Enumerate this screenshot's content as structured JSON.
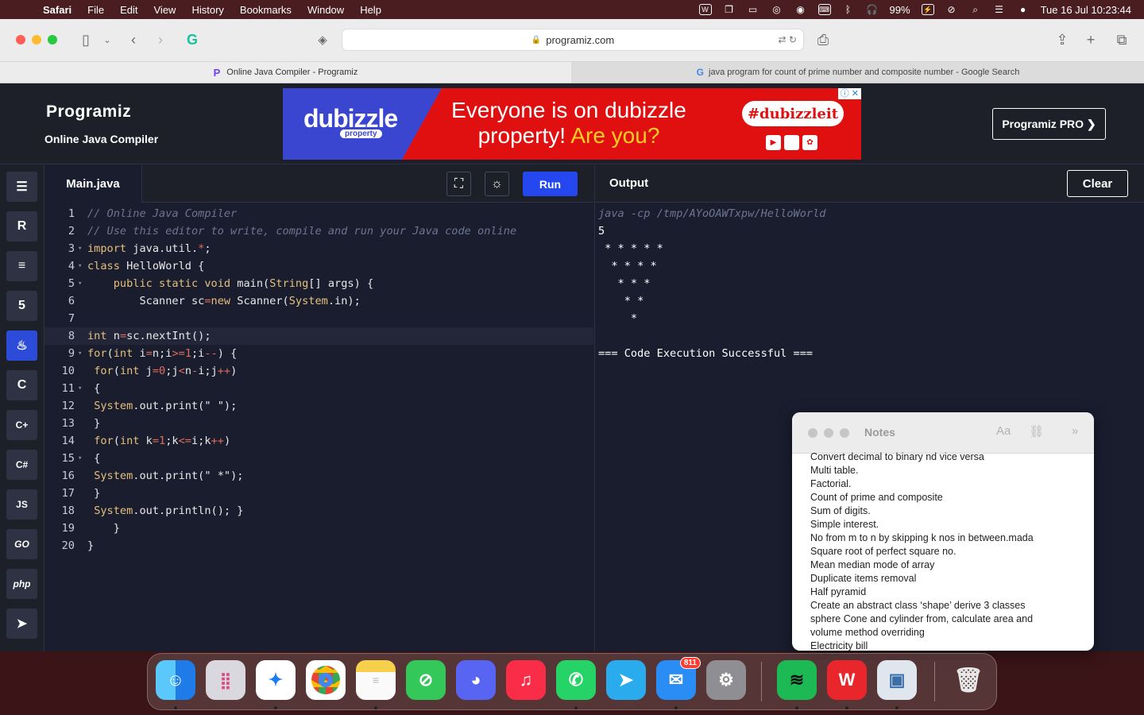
{
  "menubar": {
    "app": "Safari",
    "items": [
      "File",
      "Edit",
      "View",
      "History",
      "Bookmarks",
      "Window",
      "Help"
    ],
    "battery": "99%",
    "clock": "Tue 16 Jul  10:23:44"
  },
  "browser": {
    "url": "programiz.com",
    "tabs": [
      {
        "title": "Online Java Compiler - Programiz"
      },
      {
        "title": "java program for count of prime number and composite number - Google Search"
      }
    ]
  },
  "site": {
    "logo": "Programiz",
    "subtitle": "Online Java Compiler",
    "pro_button": "Programiz PRO ❯",
    "ad": {
      "brand": "dubizzle",
      "brand_sub": "property",
      "line1": "Everyone is on dubizzle",
      "line2a": "property!",
      "line2b": "Are you?",
      "hashtag": "#dubizzleit"
    }
  },
  "sidebar_langs": [
    {
      "name": "python",
      "glyph": "☰"
    },
    {
      "name": "r",
      "glyph": "R"
    },
    {
      "name": "sql",
      "glyph": "≡"
    },
    {
      "name": "html",
      "glyph": "5"
    },
    {
      "name": "java",
      "glyph": "♨"
    },
    {
      "name": "c",
      "glyph": "C"
    },
    {
      "name": "cpp",
      "glyph": "C+"
    },
    {
      "name": "csharp",
      "glyph": "C#"
    },
    {
      "name": "js",
      "glyph": "JS"
    },
    {
      "name": "go",
      "glyph": "GO"
    },
    {
      "name": "php",
      "glyph": "php"
    },
    {
      "name": "swift",
      "glyph": "➤"
    }
  ],
  "editor": {
    "filename": "Main.java",
    "run_label": "Run"
  },
  "output": {
    "title": "Output",
    "clear_label": "Clear",
    "lines": [
      "java -cp /tmp/AYoOAWTxpw/HelloWorld",
      "5",
      " * * * * *",
      "  * * * *",
      "   * * *",
      "    * *",
      "     *",
      "",
      "=== Code Execution Successful ==="
    ]
  },
  "notes": {
    "title": "Notes",
    "lines": [
      "Convert decimal to binary nd vice versa",
      "Multi table.",
      "Factorial.",
      "Count of prime and composite",
      "Sum of digits.",
      "Simple interest.",
      "No from m to n by skipping k nos in between.mada",
      "Square root of perfect square no.",
      "Mean median mode of array",
      "Duplicate items removal",
      "Half pyramid",
      "Create an abstract class ‘shape’ derive 3 classes",
      "sphere Cone and cylinder from, calculate area and",
      "volume method overriding",
      "Electricity bill"
    ]
  },
  "dock": {
    "apps": [
      "Finder",
      "Launchpad",
      "Safari",
      "Chrome",
      "Notes",
      "Restrict",
      "Discord",
      "Music",
      "WhatsApp",
      "Telegram",
      "Mail",
      "System Settings",
      "Spotify",
      "WPS Office",
      "Preview",
      "Trash"
    ],
    "mail_badge": "811"
  }
}
